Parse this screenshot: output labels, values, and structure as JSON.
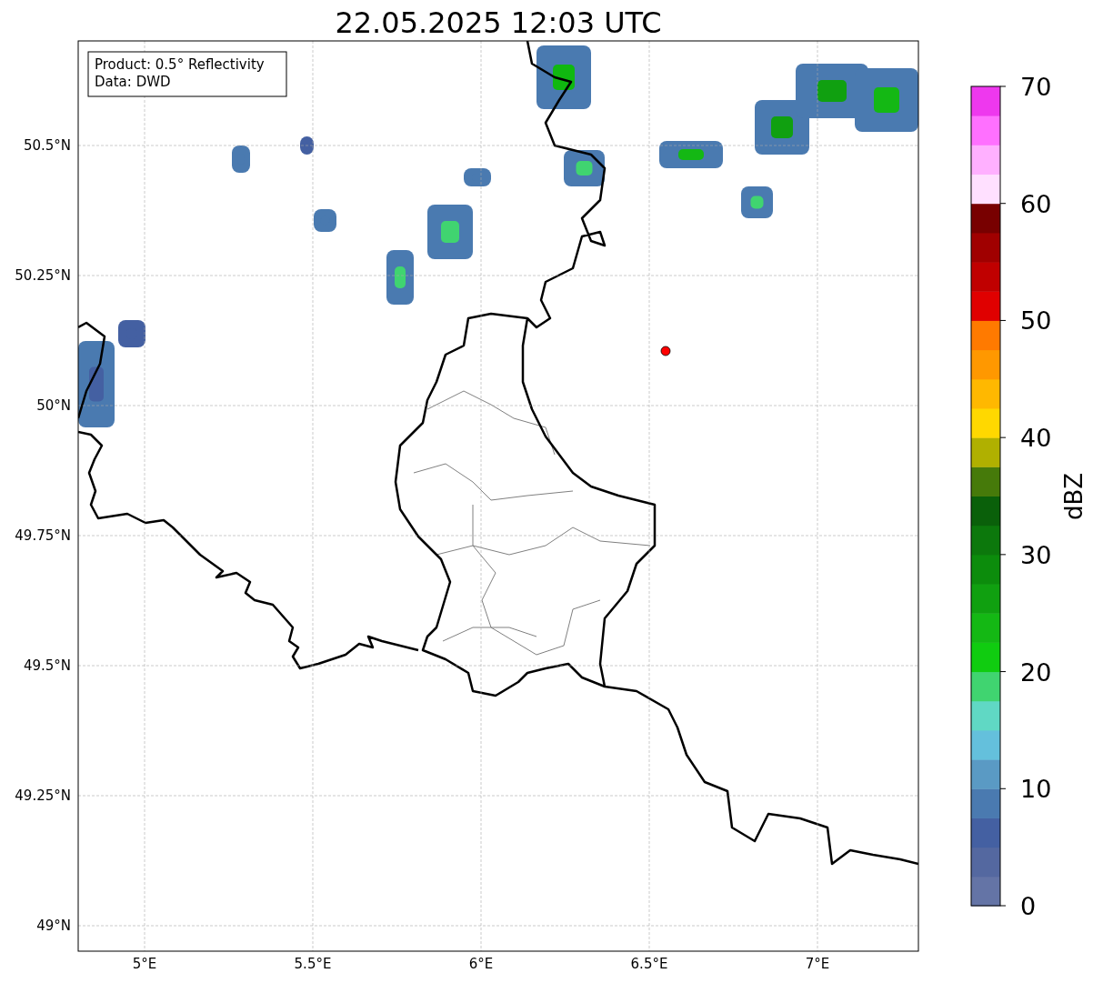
{
  "title": "22.05.2025 12:03 UTC",
  "info_box": [
    "Product: 0.5° Reflectivity",
    "Data: DWD"
  ],
  "y_axis": {
    "ticks": [
      "50.5°N",
      "50.25°N",
      "50°N",
      "49.75°N",
      "49.5°N",
      "49.25°N",
      "49°N"
    ]
  },
  "x_axis": {
    "ticks": [
      "5°E",
      "5.5°E",
      "6°E",
      "6.5°E",
      "7°E"
    ]
  },
  "colorbar": {
    "label": "dBZ",
    "ticks": [
      "70",
      "60",
      "50",
      "40",
      "30",
      "20",
      "10",
      "0"
    ],
    "segments": [
      {
        "color": "#6474a6"
      },
      {
        "color": "#5468a0"
      },
      {
        "color": "#4460a2"
      },
      {
        "color": "#4a7ab0"
      },
      {
        "color": "#5a9ac4"
      },
      {
        "color": "#64c0dc"
      },
      {
        "color": "#60d8c4"
      },
      {
        "color": "#40d470"
      },
      {
        "color": "#10cc10"
      },
      {
        "color": "#14b814"
      },
      {
        "color": "#10a010"
      },
      {
        "color": "#0c8c0c"
      },
      {
        "color": "#0c780c"
      },
      {
        "color": "#0a600a"
      },
      {
        "color": "#467a0a"
      },
      {
        "color": "#b0b000"
      },
      {
        "color": "#ffd800"
      },
      {
        "color": "#ffb800"
      },
      {
        "color": "#ff9800"
      },
      {
        "color": "#ff7a00"
      },
      {
        "color": "#e00000"
      },
      {
        "color": "#c00000"
      },
      {
        "color": "#a00000"
      },
      {
        "color": "#780000"
      },
      {
        "color": "#ffe0ff"
      },
      {
        "color": "#ffb0ff"
      },
      {
        "color": "#ff70ff"
      },
      {
        "color": "#ee38ee"
      }
    ]
  }
}
